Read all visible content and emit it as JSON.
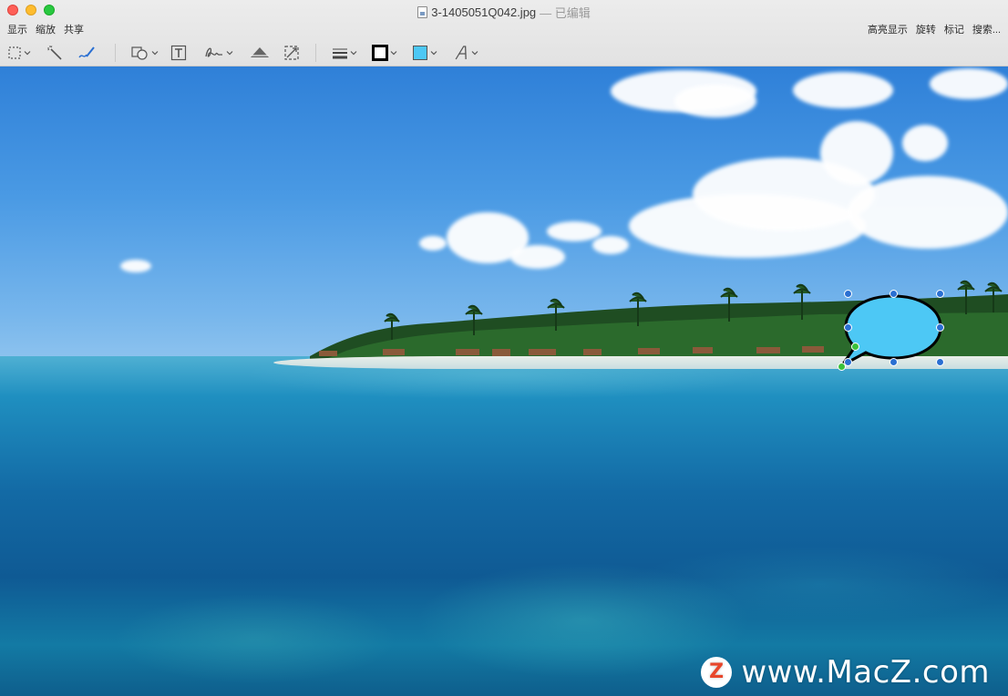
{
  "window": {
    "title": "3-1405051Q042.jpg",
    "edited_suffix": "— 已编辑"
  },
  "menu_left": [
    "显示",
    "缩放",
    "共享"
  ],
  "menu_right": [
    "高亮显示",
    "旋转",
    "标记",
    "搜索..."
  ],
  "toolbar_tools": [
    {
      "name": "selection-tool",
      "icon": "dashed-rect-select-icon"
    },
    {
      "name": "instant-alpha",
      "icon": "magic-wand-icon"
    },
    {
      "name": "sketch",
      "icon": "pen-sketch-icon"
    },
    {
      "name": "shapes",
      "icon": "shapes-icon"
    },
    {
      "name": "text",
      "icon": "text-box-icon"
    },
    {
      "name": "sign",
      "icon": "signature-icon"
    },
    {
      "name": "adjust-color",
      "icon": "adjust-color-icon"
    },
    {
      "name": "adjust-size",
      "icon": "resize-icon"
    },
    {
      "name": "shape-style",
      "icon": "line-style-icon"
    },
    {
      "name": "border-color",
      "icon": "border-color-icon"
    },
    {
      "name": "fill-color",
      "icon": "fill-color-icon"
    },
    {
      "name": "text-style",
      "icon": "text-style-icon"
    }
  ],
  "colors": {
    "border_swatch": "#000000",
    "fill_swatch": "#4dc8f5",
    "bubble_fill": "#4dc8f5",
    "selection_handle": "#2a6fd2",
    "selection_handle_alt": "#3bc13b"
  },
  "watermark": {
    "logo_letter": "Z",
    "text": "www.MacZ.com"
  }
}
